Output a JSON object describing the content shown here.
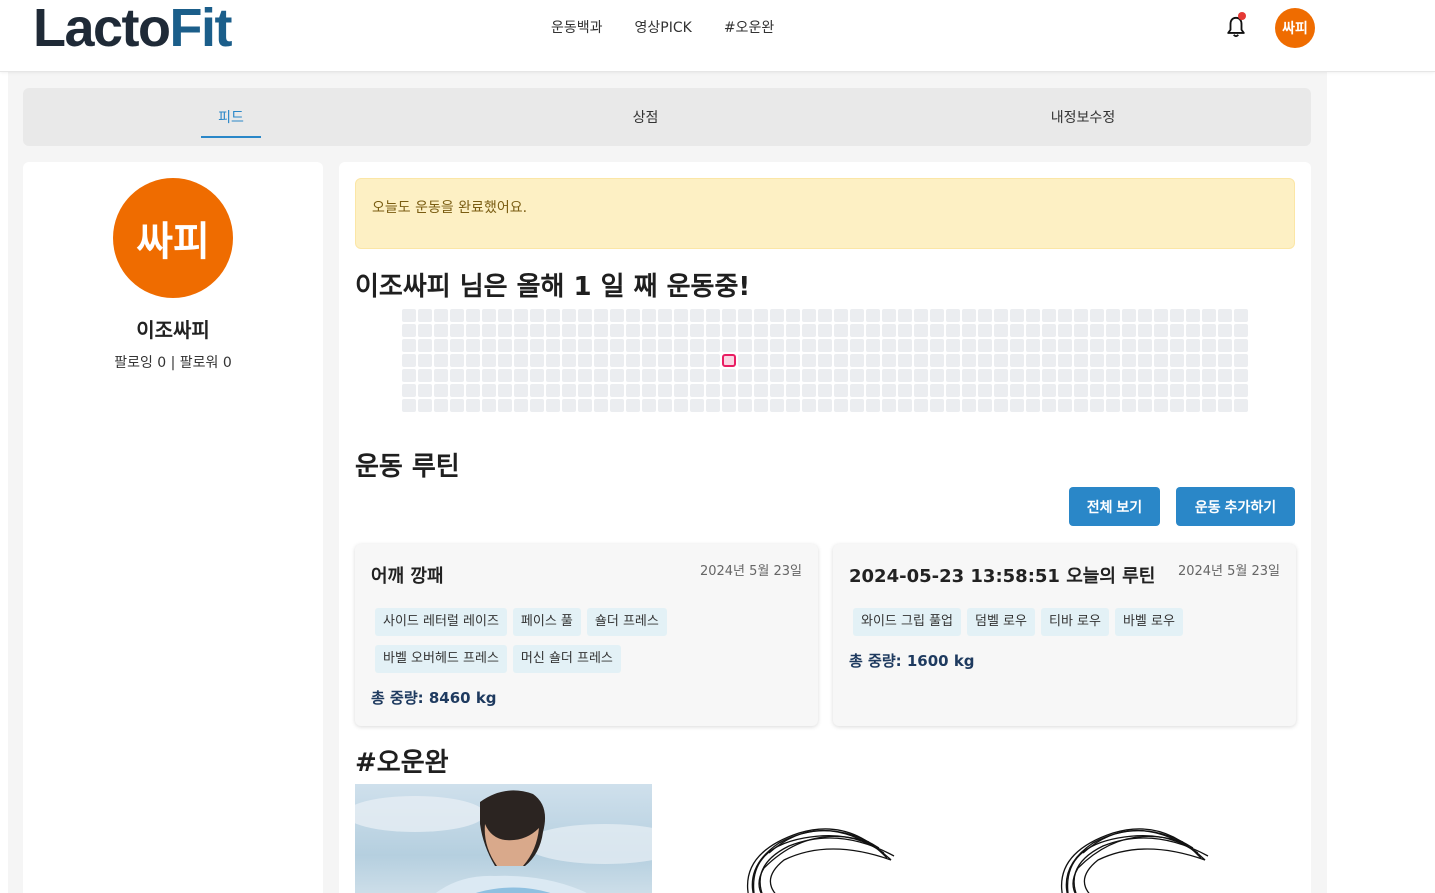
{
  "header": {
    "logo_part1": "Lacto",
    "logo_part2": "Fit",
    "nav": [
      "운동백과",
      "영상PICK",
      "#오운완"
    ],
    "avatar_label": "싸피",
    "colors": {
      "logo_dark": "#1f2a37",
      "logo_accent": "#1b5e8a",
      "avatar": "#ef6c00",
      "notification_dot": "#e53935"
    }
  },
  "tabs": [
    {
      "label": "피드",
      "active": true
    },
    {
      "label": "상점",
      "active": false
    },
    {
      "label": "내정보수정",
      "active": false
    }
  ],
  "profile": {
    "avatar_label": "싸피",
    "name": "이조싸피",
    "follow_text": "팔로잉 0 | 팔로워 0"
  },
  "main": {
    "alert_text": "오늘도 운동을 완료했어요.",
    "streak_title": "이조싸피 님은 올해  1 일 째 운동중!",
    "activity_grid": {
      "rows": 7,
      "columns": 53,
      "highlighted_cells": [
        {
          "column": 20,
          "row": 3
        }
      ],
      "cell_color": "#ebedf0",
      "highlight_color": "#e91e63"
    },
    "routine_title": "운동 루틴",
    "view_all_label": "전체 보기",
    "add_workout_label": "운동 추가하기",
    "routines": [
      {
        "title": "어깨 깡패",
        "date": "2024년 5월 23일",
        "tags": [
          "사이드 레터럴 레이즈",
          "페이스 풀",
          "숄더 프레스",
          "바벨 오버헤드 프레스",
          "머신 숄더 프레스"
        ],
        "total_weight": "총 중량: 8460 kg"
      },
      {
        "title": "2024-05-23 13:58:51 오늘의 루틴",
        "date": "2024년 5월 23일",
        "tags": [
          "와이드 그립 풀업",
          "덤벨 로우",
          "티바 로우",
          "바벨 로우"
        ],
        "total_weight": "총 중량: 1600 kg"
      }
    ],
    "ootd_title": "#오운완"
  }
}
